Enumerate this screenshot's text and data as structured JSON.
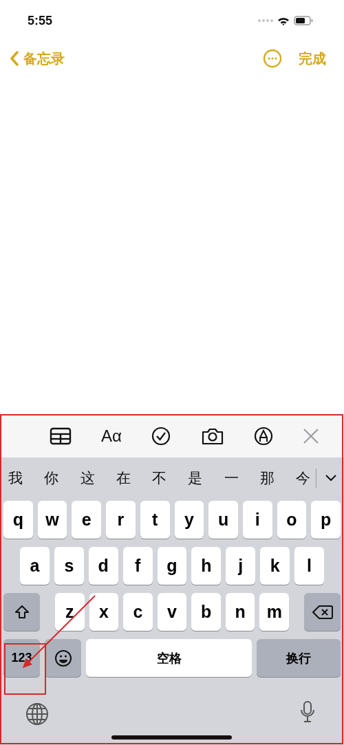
{
  "status_bar": {
    "time": "5:55"
  },
  "nav": {
    "back_label": "备忘录",
    "done_label": "完成"
  },
  "toolbar": {
    "items": [
      {
        "kind": "table"
      },
      {
        "kind": "format",
        "label": "Aα"
      },
      {
        "kind": "checklist"
      },
      {
        "kind": "camera"
      },
      {
        "kind": "markup"
      },
      {
        "kind": "close"
      }
    ]
  },
  "candidates": {
    "items": [
      "我",
      "你",
      "这",
      "在",
      "不",
      "是",
      "一",
      "那",
      "今"
    ]
  },
  "keyboard": {
    "rows": [
      {
        "keys": [
          {
            "kind": "letter",
            "label": "q"
          },
          {
            "kind": "letter",
            "label": "w"
          },
          {
            "kind": "letter",
            "label": "e"
          },
          {
            "kind": "letter",
            "label": "r"
          },
          {
            "kind": "letter",
            "label": "t"
          },
          {
            "kind": "letter",
            "label": "y"
          },
          {
            "kind": "letter",
            "label": "u"
          },
          {
            "kind": "letter",
            "label": "i"
          },
          {
            "kind": "letter",
            "label": "o"
          },
          {
            "kind": "letter",
            "label": "p"
          }
        ]
      },
      {
        "keys": [
          {
            "kind": "letter",
            "label": "a"
          },
          {
            "kind": "letter",
            "label": "s"
          },
          {
            "kind": "letter",
            "label": "d"
          },
          {
            "kind": "letter",
            "label": "f"
          },
          {
            "kind": "letter",
            "label": "g"
          },
          {
            "kind": "letter",
            "label": "h"
          },
          {
            "kind": "letter",
            "label": "j"
          },
          {
            "kind": "letter",
            "label": "k"
          },
          {
            "kind": "letter",
            "label": "l"
          }
        ]
      },
      {
        "keys": [
          {
            "kind": "shift"
          },
          {
            "kind": "letter",
            "label": "z"
          },
          {
            "kind": "letter",
            "label": "x"
          },
          {
            "kind": "letter",
            "label": "c"
          },
          {
            "kind": "letter",
            "label": "v"
          },
          {
            "kind": "letter",
            "label": "b"
          },
          {
            "kind": "letter",
            "label": "n"
          },
          {
            "kind": "letter",
            "label": "m"
          },
          {
            "kind": "delete"
          }
        ]
      },
      {
        "keys": [
          {
            "kind": "numbers",
            "label": "123"
          },
          {
            "kind": "emoji"
          },
          {
            "kind": "space",
            "label": "空格"
          },
          {
            "kind": "return",
            "label": "换行"
          }
        ]
      }
    ]
  }
}
